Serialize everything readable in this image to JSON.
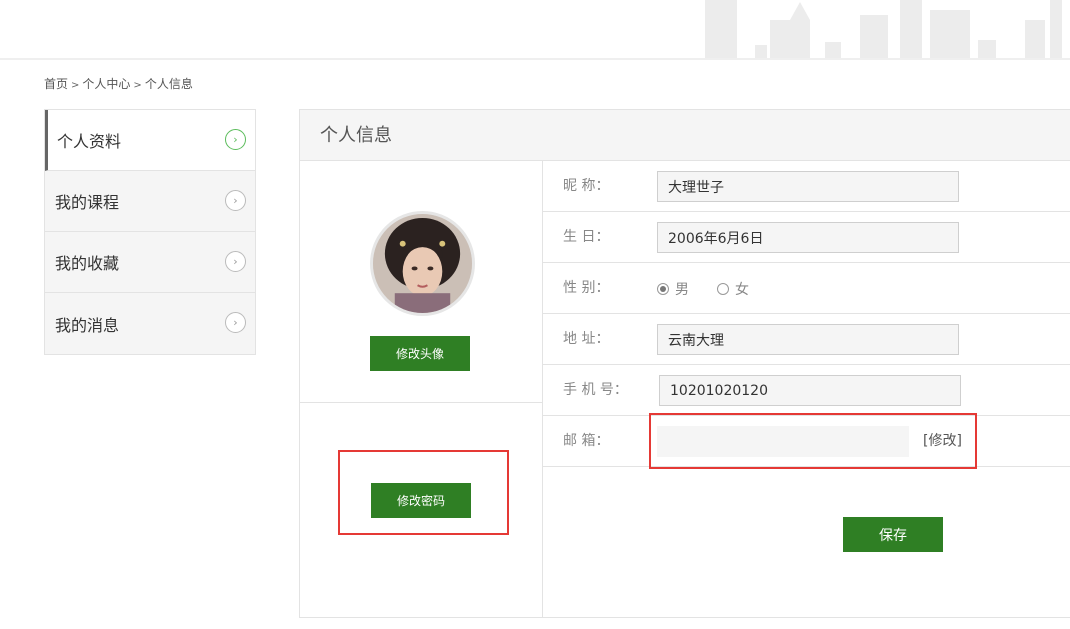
{
  "breadcrumb": {
    "home": "首页",
    "center": "个人中心",
    "current": "个人信息",
    "sep": ">"
  },
  "sidebar": {
    "items": [
      {
        "label": "个人资料",
        "active": true
      },
      {
        "label": "我的课程",
        "active": false
      },
      {
        "label": "我的收藏",
        "active": false
      },
      {
        "label": "我的消息",
        "active": false
      }
    ],
    "arrow_glyph": "›"
  },
  "panel": {
    "title": "个人信息",
    "change_avatar_label": "修改头像",
    "change_password_label": "修改密码"
  },
  "form": {
    "nickname_label": "昵    称：",
    "nickname_value": "大理世子",
    "birthday_label": "生    日：",
    "birthday_value": "2006年6月6日",
    "gender_label": "性    别：",
    "gender_options": [
      "男",
      "女"
    ],
    "gender_selected": "男",
    "address_label": "地    址：",
    "address_value": "云南大理",
    "phone_label": "手 机 号：",
    "phone_value": "10201020120",
    "email_label": "邮    箱：",
    "email_modify": "[修改]",
    "save_label": "保存"
  },
  "colors": {
    "accent_green": "#2f7f24",
    "active_arrow": "#5bbc5b",
    "highlight_red": "#e53935"
  }
}
